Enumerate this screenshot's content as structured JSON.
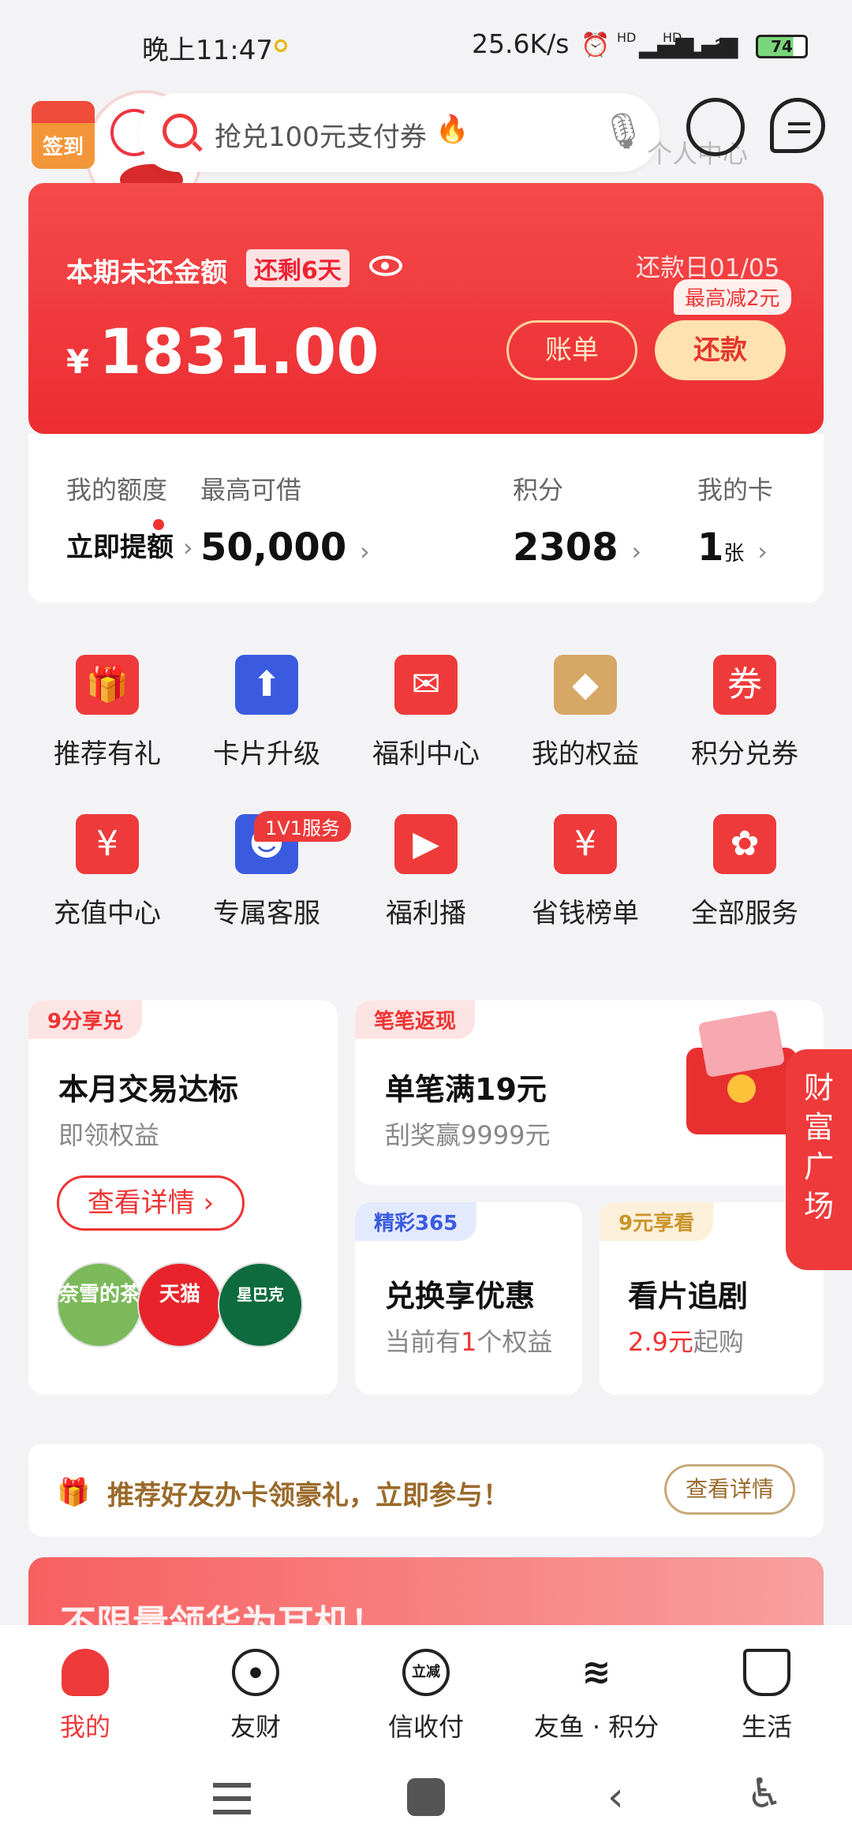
{
  "status_bar": {
    "time": "晚上11:47",
    "net_speed": "25.6K/s",
    "signal1": "HD",
    "signal2": "HD",
    "battery": "74"
  },
  "header": {
    "checkin_label": "签到",
    "search_placeholder": "抢兑100元支付券",
    "ghost_text": "个人中心"
  },
  "bill_card": {
    "label": "本期未还金额",
    "days_left": "还剩6天",
    "due_date": "还款日01/05",
    "amount": "1831.00",
    "currency": "¥",
    "bill_button": "账单",
    "pay_button": "还款",
    "discount_tip": "最高减2元"
  },
  "stats": [
    {
      "title": "我的额度",
      "value": "立即提额"
    },
    {
      "title": "最高可借",
      "value": "50,000"
    },
    {
      "title": "积分",
      "value": "2308"
    },
    {
      "title": "我的卡",
      "value": "1",
      "unit": "张"
    }
  ],
  "services": [
    {
      "label": "推荐有礼",
      "icon": "gift-icon",
      "glyph": "🎁",
      "color": "#ee3a3a"
    },
    {
      "label": "卡片升级",
      "icon": "card-upgrade-icon",
      "glyph": "⬆",
      "color": "#3a5be0"
    },
    {
      "label": "福利中心",
      "icon": "red-envelope-icon",
      "glyph": "✉",
      "color": "#ee3a3a"
    },
    {
      "label": "我的权益",
      "icon": "diamond-icon",
      "glyph": "◆",
      "color": "#d7a765"
    },
    {
      "label": "积分兑券",
      "icon": "coupon-icon",
      "glyph": "券",
      "color": "#ee3a3a"
    },
    {
      "label": "充值中心",
      "icon": "recharge-icon",
      "glyph": "¥",
      "color": "#ee3a3a"
    },
    {
      "label": "专属客服",
      "icon": "agent-icon",
      "glyph": "☻",
      "color": "#3a5be0"
    },
    {
      "label": "福利播",
      "icon": "video-icon",
      "glyph": "▶",
      "color": "#ee3a3a"
    },
    {
      "label": "省钱榜单",
      "icon": "piggy-bank-icon",
      "glyph": "¥",
      "color": "#ee3a3a"
    },
    {
      "label": "全部服务",
      "icon": "grid-icon",
      "glyph": "✿",
      "color": "#ee3a3a"
    }
  ],
  "service_tag": "1V1服务",
  "promo_left": {
    "tag": "9分享兑",
    "title": "本月交易达标",
    "subtitle": "即领权益",
    "button": "查看详情 ›",
    "brands": [
      "奈雪的茶",
      "天猫",
      "星巴克"
    ]
  },
  "promo_right_top": {
    "tag": "笔笔返现",
    "title": "单笔满19元",
    "subtitle": "刮奖赢9999元"
  },
  "promo_mid": {
    "tag": "精彩365",
    "title": "兑换享优惠",
    "sub_prefix": "当前有",
    "sub_count": "1",
    "sub_suffix": "个权益"
  },
  "promo_small": {
    "tag": "9元享看",
    "title": "看片追剧",
    "price": "2.9元",
    "price_suffix": "起购"
  },
  "side_tab": "财富广场",
  "referral": {
    "text": "推荐好友办卡领豪礼，立即参与！",
    "button": "查看详情"
  },
  "banner_text": "不限量领华为耳机！",
  "nav": [
    {
      "label": "我的",
      "icon": "me-icon",
      "active": true
    },
    {
      "label": "友财",
      "icon": "target-icon",
      "active": false
    },
    {
      "label": "信收付",
      "icon": "instant-discount-icon",
      "glyph": "立减",
      "active": false
    },
    {
      "label": "友鱼 · 积分",
      "icon": "fish-icon",
      "active": false
    },
    {
      "label": "生活",
      "icon": "cup-icon",
      "active": false
    }
  ],
  "accent_color": "#ee3a3a"
}
